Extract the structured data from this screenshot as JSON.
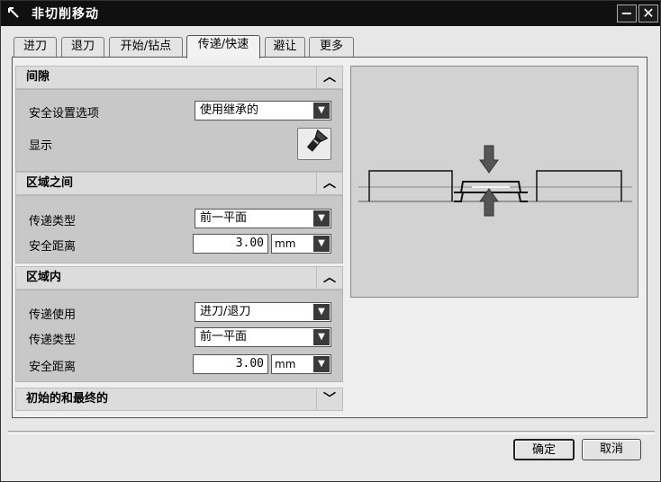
{
  "window": {
    "title": "非切削移动"
  },
  "tabs": [
    {
      "label": "进刀",
      "active": false
    },
    {
      "label": "退刀",
      "active": false
    },
    {
      "label": "开始/钻点",
      "active": false
    },
    {
      "label": "传递/快速",
      "active": true
    },
    {
      "label": "避让",
      "active": false
    },
    {
      "label": "更多",
      "active": false
    }
  ],
  "clearance": {
    "title": "间隙",
    "safety_option_label": "安全设置选项",
    "safety_option_value": "使用继承的",
    "display_label": "显示"
  },
  "between_regions": {
    "title": "区域之间",
    "transfer_type_label": "传递类型",
    "transfer_type_value": "前一平面",
    "safe_distance_label": "安全距离",
    "safe_distance_value": "3.00",
    "unit": "mm"
  },
  "within_region": {
    "title": "区域内",
    "transfer_using_label": "传递使用",
    "transfer_using_value": "进刀/退刀",
    "transfer_type_label": "传递类型",
    "transfer_type_value": "前一平面",
    "safe_distance_label": "安全距离",
    "safe_distance_value": "3.00",
    "unit": "mm"
  },
  "initial_final": {
    "title": "初始的和最终的"
  },
  "footer": {
    "ok_label": "确定",
    "cancel_label": "取消"
  }
}
